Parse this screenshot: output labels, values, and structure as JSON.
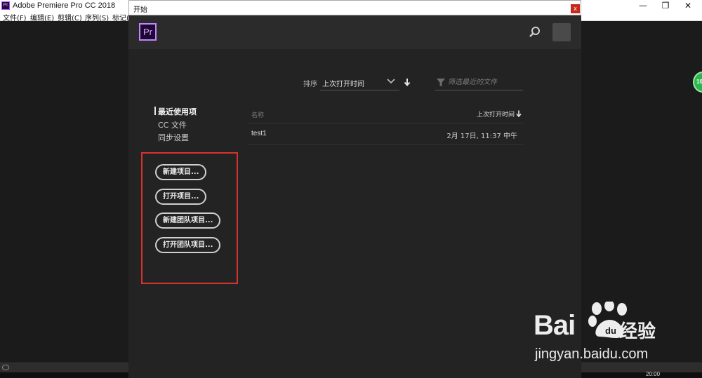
{
  "app": {
    "title": "Adobe Premiere Pro CC 2018",
    "logo_text": "Pr",
    "menu": [
      "文件(F)",
      "编辑(E)",
      "剪辑(C)",
      "序列(S)",
      "标记(M"
    ],
    "window_controls": [
      "—",
      "❐",
      "✕"
    ],
    "taskbar_time": "20:00"
  },
  "dialog": {
    "title": "开始",
    "close_label": "x",
    "logo_text": "Pr"
  },
  "sort": {
    "label": "排序",
    "value": "上次打开时间",
    "filter_placeholder": "筛选最近的文件"
  },
  "nav": {
    "items": [
      "最近使用项",
      "CC 文件",
      "同步设置"
    ],
    "active_index": 0
  },
  "actions": {
    "buttons": [
      "新建项目...",
      "打开项目...",
      "新建团队项目...",
      "打开团队项目..."
    ]
  },
  "table": {
    "columns": [
      "名称",
      "上次打开时间"
    ],
    "rows": [
      {
        "name": "test1",
        "opened": "2月 17日, 11:37 中午"
      }
    ]
  },
  "badge": {
    "text": "10"
  },
  "watermark": {
    "brand": "Bai",
    "brand_cn": "经验",
    "url": "jingyan.baidu.com"
  },
  "colors": {
    "dialog_bg": "#232323",
    "header_bg": "#2b2b2b",
    "highlight_box": "#d8322d",
    "pr_purple": "#c184ff"
  },
  "icons": {
    "search": "search-icon",
    "filter": "filter-icon",
    "sort_direction": "arrow-down-icon",
    "dropdown": "chevron-down-icon"
  }
}
